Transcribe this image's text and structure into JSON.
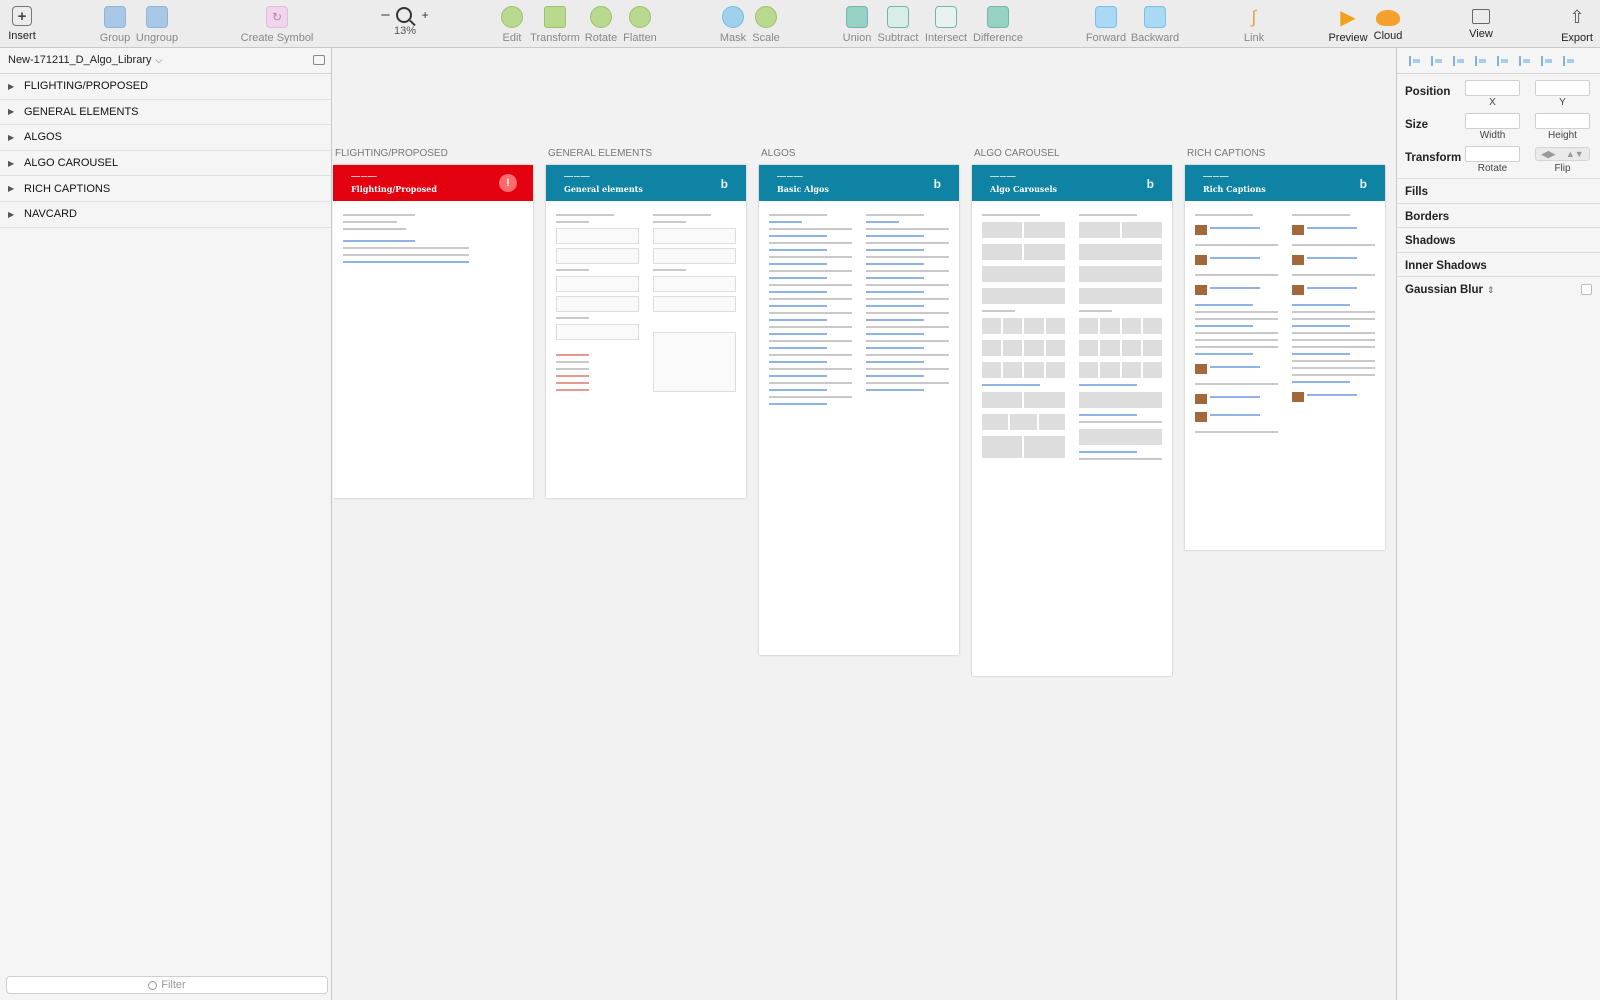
{
  "toolbar": {
    "insert": "Insert",
    "group": "Group",
    "ungroup": "Ungroup",
    "create_symbol": "Create Symbol",
    "zoom_minus": "–",
    "zoom_plus": "+",
    "zoom_level": "13%",
    "edit": "Edit",
    "transform": "Transform",
    "rotate": "Rotate",
    "flatten": "Flatten",
    "mask": "Mask",
    "scale": "Scale",
    "union": "Union",
    "subtract": "Subtract",
    "intersect": "Intersect",
    "difference": "Difference",
    "forward": "Forward",
    "backward": "Backward",
    "link": "Link",
    "preview": "Preview",
    "cloud": "Cloud",
    "view": "View",
    "export": "Export"
  },
  "sidebar": {
    "document_title": "New-171211_D_Algo_Library",
    "pages": [
      {
        "label": "FLIGHTING/PROPOSED"
      },
      {
        "label": "GENERAL ELEMENTS"
      },
      {
        "label": "ALGOS"
      },
      {
        "label": "ALGO CAROUSEL"
      },
      {
        "label": "RICH CAPTIONS"
      },
      {
        "label": "NAVCARD"
      }
    ],
    "filter_placeholder": "Filter"
  },
  "canvas": {
    "artboards": [
      {
        "label": "FLIGHTING/PROPOSED",
        "title": "Flighting/Proposed",
        "header_color": "#e3000f"
      },
      {
        "label": "GENERAL ELEMENTS",
        "title": "General elements",
        "header_color": "#0e83a3"
      },
      {
        "label": "ALGOS",
        "title": "Basic Algos",
        "header_color": "#0e83a3"
      },
      {
        "label": "ALGO CAROUSEL",
        "title": "Algo Carousels",
        "header_color": "#0e83a3"
      },
      {
        "label": "RICH CAPTIONS",
        "title": "Rich Captions",
        "header_color": "#0e83a3"
      }
    ]
  },
  "inspector": {
    "position": "Position",
    "x": "X",
    "y": "Y",
    "size": "Size",
    "width": "Width",
    "height": "Height",
    "transform": "Transform",
    "rotate": "Rotate",
    "flip": "Flip",
    "fills": "Fills",
    "borders": "Borders",
    "shadows": "Shadows",
    "inner_shadows": "Inner Shadows",
    "gaussian_blur": "Gaussian Blur"
  },
  "colors": {
    "accent_red": "#e3000f",
    "accent_teal": "#0e83a3"
  }
}
